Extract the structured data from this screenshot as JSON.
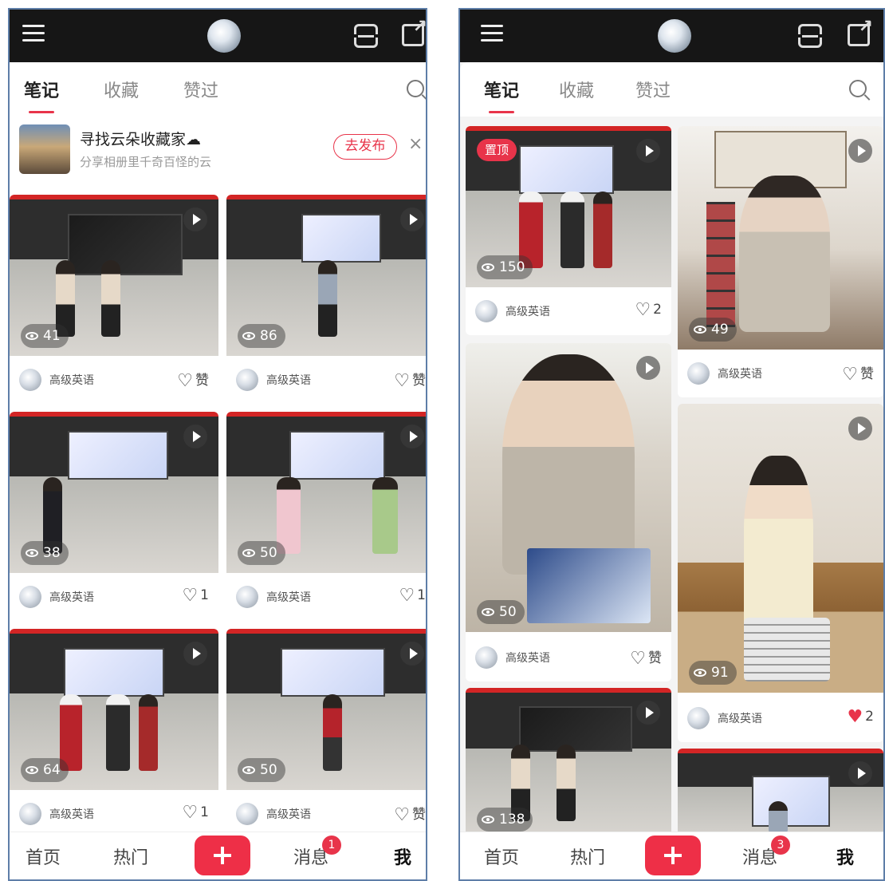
{
  "left": {
    "tabs": [
      "笔记",
      "收藏",
      "赞过"
    ],
    "banner": {
      "title": "寻找云朵收藏家☁",
      "subtitle": "分享相册里千奇百怪的云",
      "publish_label": "去发布",
      "close_label": "×"
    },
    "cards": [
      {
        "views": "41",
        "author": "高级英语",
        "likes": "赞"
      },
      {
        "views": "86",
        "author": "高级英语",
        "likes": "赞"
      },
      {
        "views": "38",
        "author": "高级英语",
        "likes": "1"
      },
      {
        "views": "50",
        "author": "高级英语",
        "likes": "1"
      },
      {
        "views": "64",
        "author": "高级英语",
        "likes": "1"
      },
      {
        "views": "50",
        "author": "高级英语",
        "likes": "赞"
      }
    ],
    "nav": {
      "home": "首页",
      "hot": "热门",
      "messages": "消息",
      "me": "我",
      "badge": "1"
    }
  },
  "right": {
    "tabs": [
      "笔记",
      "收藏",
      "赞过"
    ],
    "pin_label": "置顶",
    "cards": [
      {
        "views": "150",
        "author": "高级英语",
        "likes": "2"
      },
      {
        "views": "49",
        "author": "高级英语",
        "likes": "赞"
      },
      {
        "views": "50",
        "author": "高级英语",
        "likes": "赞"
      },
      {
        "views": "91",
        "author": "高级英语",
        "likes": "2"
      },
      {
        "views": "138"
      }
    ],
    "nav": {
      "home": "首页",
      "hot": "热门",
      "messages": "消息",
      "me": "我",
      "badge": "3"
    }
  },
  "colors": {
    "accent": "#e8344a",
    "topbar": "#161616",
    "frame": "#5e7ea8"
  }
}
